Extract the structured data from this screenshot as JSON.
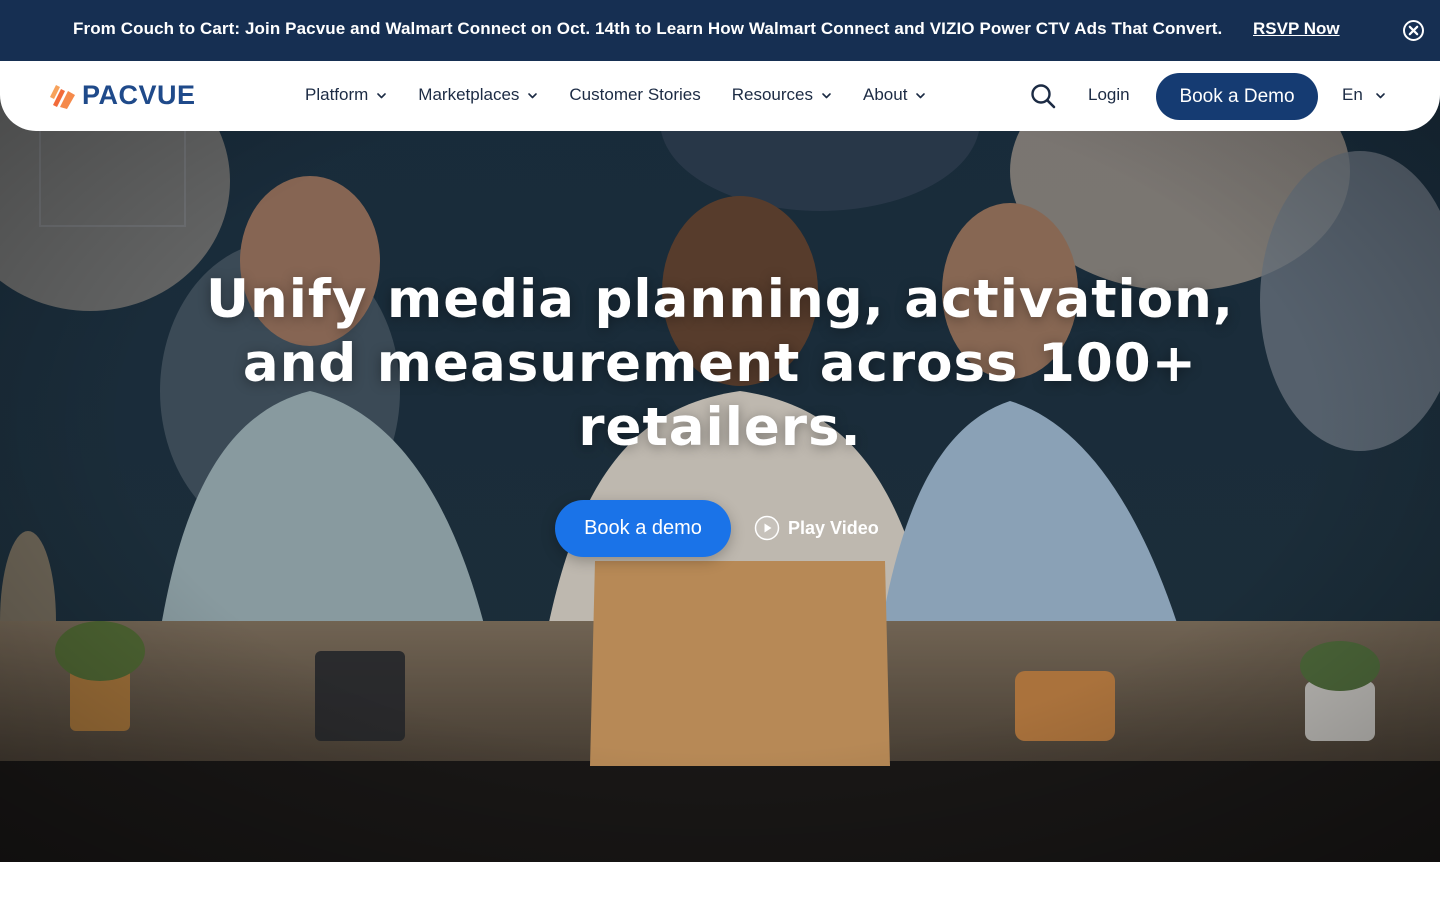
{
  "announcement": {
    "text": "From Couch to Cart: Join Pacvue and Walmart Connect on Oct. 14th to Learn How Walmart Connect and VIZIO Power CTV Ads That Convert.",
    "link_label": "RSVP Now",
    "close_icon": "close-circle-icon",
    "background": "#162f52"
  },
  "header": {
    "logo_text": "PACVUE",
    "nav": [
      {
        "label": "Platform",
        "has_dropdown": true
      },
      {
        "label": "Marketplaces",
        "has_dropdown": true
      },
      {
        "label": "Customer Stories",
        "has_dropdown": false
      },
      {
        "label": "Resources",
        "has_dropdown": true
      },
      {
        "label": "About",
        "has_dropdown": true
      }
    ],
    "search_icon": "search-icon",
    "login_label": "Login",
    "demo_label": "Book a Demo",
    "language": "En",
    "accent": "#153b72"
  },
  "hero": {
    "title": "Unify media planning, activation, and measurement across 100+ retailers.",
    "cta_label": "Book a demo",
    "video_label": "Play Video",
    "cta_color": "#1a73e8"
  }
}
